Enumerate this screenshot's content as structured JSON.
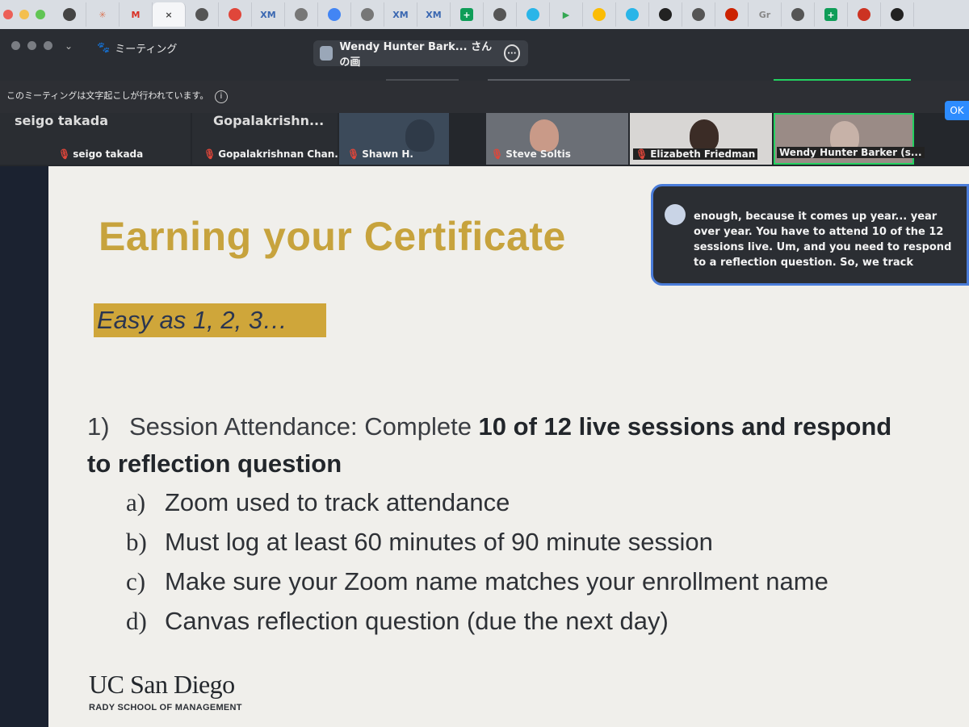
{
  "browser": {
    "traffic_colors": [
      "#ec5f57",
      "#f4bf4f",
      "#61c554"
    ],
    "tabs": [
      {
        "icon": "openai-icon",
        "label": "",
        "color": "#444444"
      },
      {
        "icon": "claude-icon",
        "label": "✳",
        "color": "#d97757"
      },
      {
        "icon": "gmail-icon",
        "label": "M",
        "color": "#d93025"
      },
      {
        "icon": "close-icon",
        "label": "×",
        "color": "#444444"
      },
      {
        "icon": "globe-icon",
        "label": "",
        "color": "#555555"
      },
      {
        "icon": "sunburst-icon",
        "label": "",
        "color": "#e0463a"
      },
      {
        "icon": "xm-icon",
        "label": "XM",
        "color": "#3a67b1"
      },
      {
        "icon": "gray-dot-icon",
        "label": "",
        "color": "#777777"
      },
      {
        "icon": "docs-icon",
        "label": "",
        "color": "#4285f4"
      },
      {
        "icon": "gray-dot-icon",
        "label": "",
        "color": "#777777"
      },
      {
        "icon": "xm-icon",
        "label": "XM",
        "color": "#3a67b1"
      },
      {
        "icon": "xm-icon",
        "label": "XM",
        "color": "#3a67b1"
      },
      {
        "icon": "sheets-icon",
        "label": "+",
        "color": "#0f9d58"
      },
      {
        "icon": "globe-icon",
        "label": "",
        "color": "#555555"
      },
      {
        "icon": "snowflake-icon",
        "label": "",
        "color": "#29b5e8"
      },
      {
        "icon": "play-icon",
        "label": "▶",
        "color": "#34a853"
      },
      {
        "icon": "drive-icon",
        "label": "",
        "color": "#fbbc04"
      },
      {
        "icon": "snowflake-icon",
        "label": "",
        "color": "#29b5e8"
      },
      {
        "icon": "circle-icon",
        "label": "",
        "color": "#222222"
      },
      {
        "icon": "globe-icon",
        "label": "",
        "color": "#555555"
      },
      {
        "icon": "gem-icon",
        "label": "",
        "color": "#cc2200"
      },
      {
        "icon": "gr-icon",
        "label": "Gr",
        "color": "#888888"
      },
      {
        "icon": "pencil-icon",
        "label": "",
        "color": "#555555"
      },
      {
        "icon": "sheets-icon",
        "label": "+",
        "color": "#0f9d58"
      },
      {
        "icon": "flag-icon",
        "label": "",
        "color": "#cc3322"
      },
      {
        "icon": "github-icon",
        "label": "",
        "color": "#222222"
      }
    ]
  },
  "zoom": {
    "meeting_label": "ミーティング",
    "share_title": "Wendy Hunter Bark... さんの画",
    "caption_notice": "このミーティングは文字起こしが行われています。",
    "ok_label": "OK"
  },
  "participants": [
    {
      "name": "seigo takada",
      "big": "seigo takada",
      "muted": true
    },
    {
      "name": "Gopalakrishnan Chan...",
      "big": "Gopalakrishn...",
      "muted": true
    },
    {
      "name": "Shawn H.",
      "big": "",
      "muted": true
    },
    {
      "name": "Steve Soltis",
      "big": "",
      "muted": true
    },
    {
      "name": "Elizabeth Friedman",
      "big": "",
      "muted": true
    },
    {
      "name": "Wendy Hunter Barker (s...",
      "big": "",
      "muted": false
    }
  ],
  "slide": {
    "title": "Earning your Certificate",
    "tagline": "Easy as 1, 2, 3…",
    "point_number": "1)",
    "point_lead": "Session Attendance: Complete ",
    "point_bold": "10 of 12 live sessions and respond to reflection question",
    "subpoints": [
      {
        "letter": "a)",
        "text": "Zoom used to track attendance"
      },
      {
        "letter": "b)",
        "text": "Must log at least 60 minutes of 90 minute session"
      },
      {
        "letter": "c)",
        "text": "Make sure your Zoom name matches your enrollment name"
      },
      {
        "letter": "d)",
        "text": "Canvas reflection question (due the next day)"
      }
    ],
    "logo_main": "UC San Diego",
    "logo_sub": "RADY SCHOOL OF MANAGEMENT"
  },
  "caption": {
    "text": "enough, because it comes up year... year over year. You have to attend 10 of the 12 sessions live. Um, and you need to respond to a reflection question. So, we track"
  }
}
